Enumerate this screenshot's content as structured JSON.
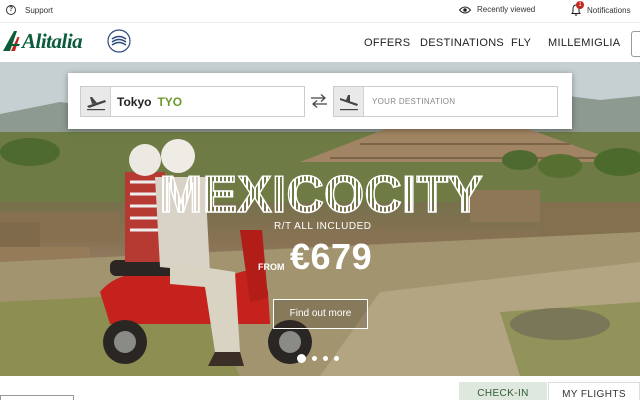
{
  "topbar": {
    "support_label": "Support",
    "support_icon": "question-icon",
    "recently_viewed_label": "Recently viewed",
    "recently_viewed_icon": "eye-icon",
    "notifications_label": "Notifications",
    "notifications_count": "1",
    "notifications_icon": "bell-icon"
  },
  "nav": {
    "logo_text": "Alitalia",
    "partner_logo_text": "SKYTEAM",
    "menu": [
      "OFFERS",
      "DESTINATIONS",
      "FLY",
      "MILLEMIGLIA"
    ]
  },
  "search": {
    "origin_city": "Tokyo",
    "origin_code": "TYO",
    "destination_placeholder": "YOUR DESTINATION"
  },
  "promo": {
    "destination_title": "MEXICOCITY",
    "subtitle": "R/T ALL INCLUDED",
    "from_label": "FROM",
    "price": "€679",
    "cta_label": "Find out more",
    "slides_total": 4,
    "active_slide": 1
  },
  "bottom": {
    "tabs": [
      "CHECK-IN",
      "MY FLIGHTS"
    ]
  },
  "colors": {
    "brand_green": "#0b5c3a",
    "airport_code_green": "#6a9b2b",
    "notification_red": "#c0261d",
    "checkin_tab_bg": "#dfe8de"
  }
}
